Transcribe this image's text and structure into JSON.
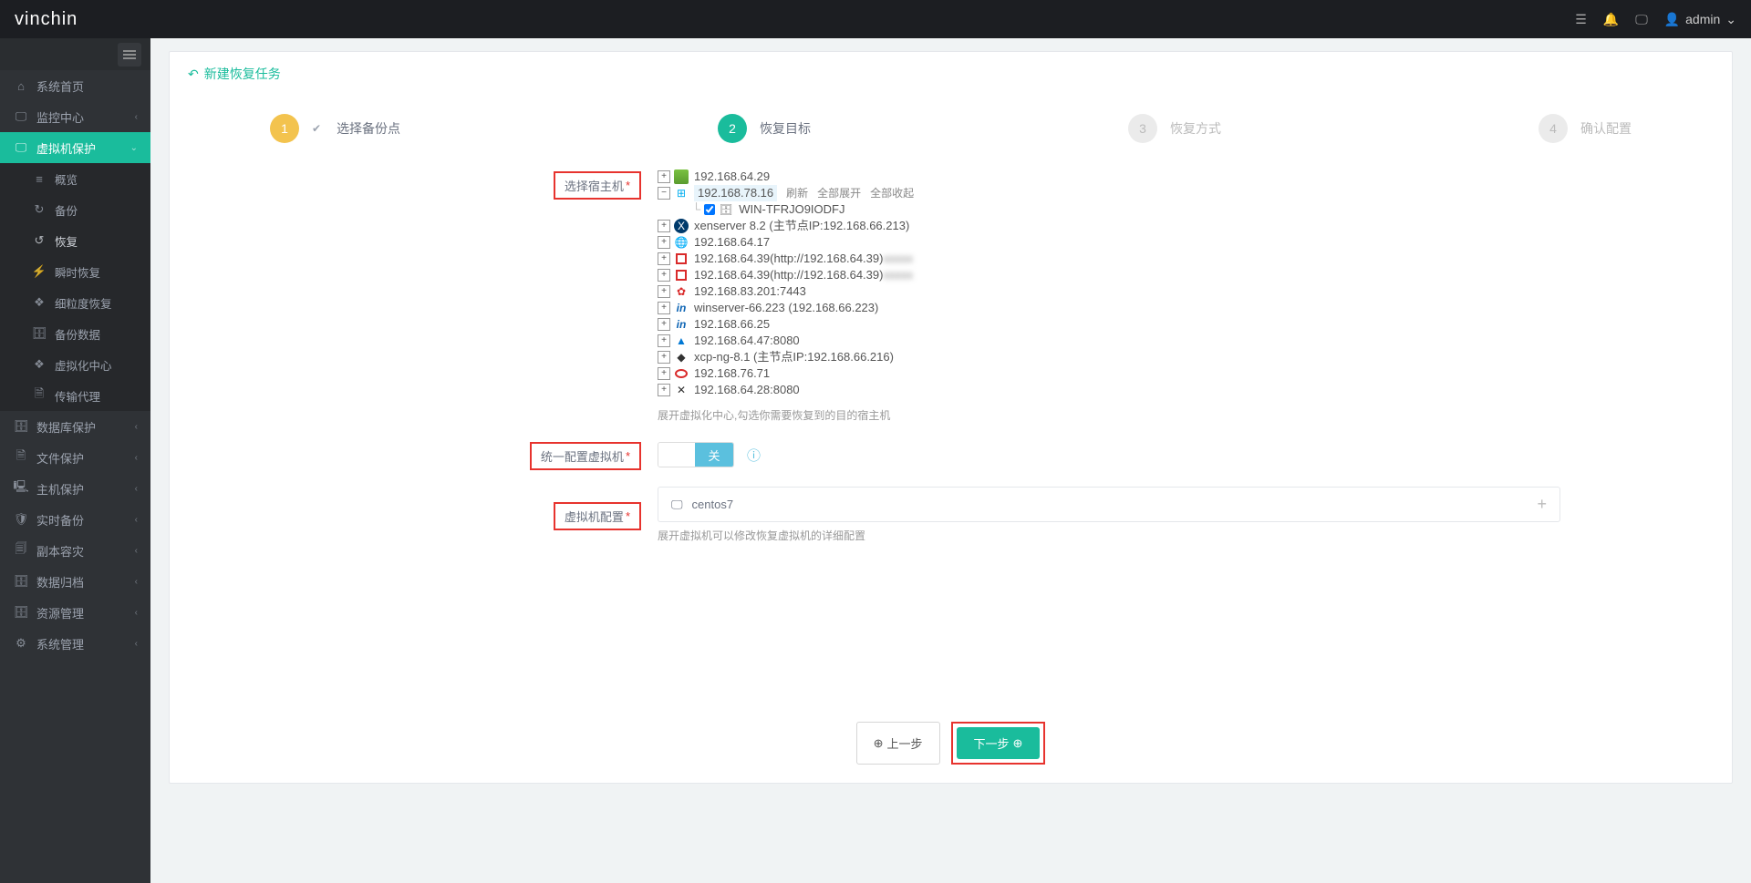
{
  "header": {
    "logo_prefix": "vin",
    "logo_suffix": "chin",
    "user": "admin"
  },
  "sidebar": {
    "items": [
      {
        "icon": "⌂",
        "label": "系统首页",
        "chev": false
      },
      {
        "icon": "🖵",
        "label": "监控中心",
        "chev": true
      },
      {
        "icon": "🖵",
        "label": "虚拟机保护",
        "chev": true,
        "active": true
      },
      {
        "icon": "🗄",
        "label": "数据库保护",
        "chev": true
      },
      {
        "icon": "🗎",
        "label": "文件保护",
        "chev": true
      },
      {
        "icon": "🖳",
        "label": "主机保护",
        "chev": true
      },
      {
        "icon": "🛡",
        "label": "实时备份",
        "chev": true
      },
      {
        "icon": "🗐",
        "label": "副本容灾",
        "chev": true
      },
      {
        "icon": "🗄",
        "label": "数据归档",
        "chev": true
      },
      {
        "icon": "🗄",
        "label": "资源管理",
        "chev": true
      },
      {
        "icon": "⚙",
        "label": "系统管理",
        "chev": true
      }
    ],
    "sub": [
      {
        "icon": "≡",
        "label": "概览"
      },
      {
        "icon": "↻",
        "label": "备份"
      },
      {
        "icon": "↺",
        "label": "恢复",
        "active": true
      },
      {
        "icon": "⚡",
        "label": "瞬时恢复"
      },
      {
        "icon": "❖",
        "label": "细粒度恢复"
      },
      {
        "icon": "🗄",
        "label": "备份数据"
      },
      {
        "icon": "❖",
        "label": "虚拟化中心"
      },
      {
        "icon": "🗎",
        "label": "传输代理"
      }
    ]
  },
  "panel": {
    "title": "新建恢复任务"
  },
  "steps": {
    "s1": {
      "num": "1",
      "label": "选择备份点",
      "check": "✔"
    },
    "s2": {
      "num": "2",
      "label": "恢复目标"
    },
    "s3": {
      "num": "3",
      "label": "恢复方式"
    },
    "s4": {
      "num": "4",
      "label": "确认配置"
    }
  },
  "form": {
    "select_host_label": "选择宿主机",
    "unified_label": "统一配置虚拟机",
    "vm_config_label": "虚拟机配置",
    "switch_text": "关",
    "tree_helper": "展开虚拟化中心,勾选你需要恢复到的目的宿主机",
    "vm_helper": "展开虚拟机可以修改恢复虚拟机的详细配置",
    "vm_name": "centos7",
    "tree_actions": {
      "refresh": "刷新",
      "expand": "全部展开",
      "collapse": "全部收起"
    },
    "hosts": [
      {
        "label": "192.168.64.29",
        "icon": "vm"
      },
      {
        "label": "192.168.78.16",
        "icon": "win",
        "expanded": true,
        "selected": true,
        "child": "WIN-TFRJO9IODFJ"
      },
      {
        "label": "xenserver 8.2 (主节点IP:192.168.66.213)",
        "icon": "xen"
      },
      {
        "label": "192.168.64.17",
        "icon": "globe"
      },
      {
        "label": "192.168.64.39(http://192.168.64.39)",
        "icon": "sq",
        "suffix_blur": true
      },
      {
        "label": "192.168.64.39(http://192.168.64.39)",
        "icon": "sq",
        "suffix_blur": true
      },
      {
        "label": "192.168.83.201:7443",
        "icon": "hua"
      },
      {
        "label": "winserver-66.223 (192.168.66.223)",
        "icon": "inspur"
      },
      {
        "label": "192.168.66.25",
        "icon": "inspur"
      },
      {
        "label": "192.168.64.47:8080",
        "icon": "azure"
      },
      {
        "label": "xcp-ng-8.1 (主节点IP:192.168.66.216)",
        "icon": "xcp"
      },
      {
        "label": "192.168.76.71",
        "icon": "red"
      },
      {
        "label": "192.168.64.28:8080",
        "icon": "x"
      }
    ]
  },
  "footer": {
    "prev": "上一步",
    "next": "下一步"
  }
}
